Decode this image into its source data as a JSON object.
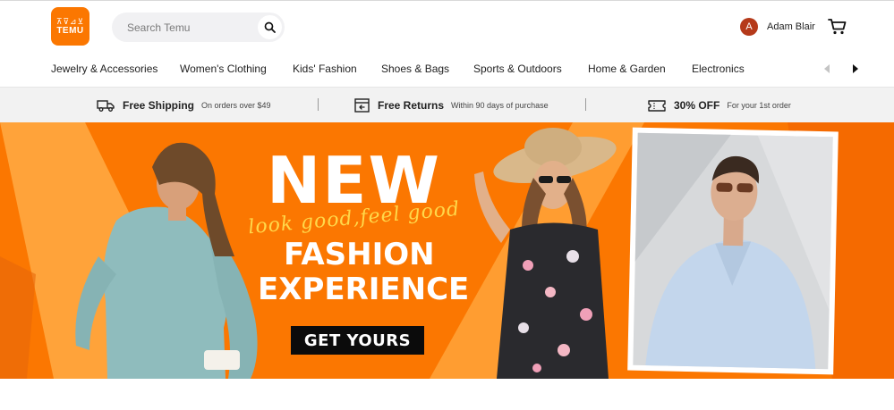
{
  "app": {
    "logo_text": "TEMU",
    "logo_glyphs": "⊼⊽⊿⊻"
  },
  "search": {
    "placeholder": "Search Temu",
    "value": ""
  },
  "user": {
    "initial": "A",
    "name": "Adam Blair"
  },
  "categories": [
    "Jewelry & Accessories",
    "Women's Clothing",
    "Kids' Fashion",
    "Shoes & Bags",
    "Sports & Outdoors",
    "Home & Garden",
    "Electronics"
  ],
  "benefits": [
    {
      "title": "Free Shipping",
      "subtitle": "On orders over $49",
      "icon": "truck-icon"
    },
    {
      "title": "Free Returns",
      "subtitle": "Within 90 days of purchase",
      "icon": "return-box-icon"
    },
    {
      "title": "30% OFF",
      "subtitle": "For your 1st order",
      "icon": "coupon-icon"
    }
  ],
  "banner": {
    "headline": "NEW",
    "tagline": "look good,feel good",
    "line1": "FASHION",
    "line2": "EXPERIENCE",
    "cta": "GET YOURS"
  },
  "colors": {
    "brand": "#fb7701",
    "banner_light": "#ffa33a",
    "cta_bg": "#0b0b0b",
    "avatar": "#b53a1a",
    "script": "#ffd84a"
  }
}
